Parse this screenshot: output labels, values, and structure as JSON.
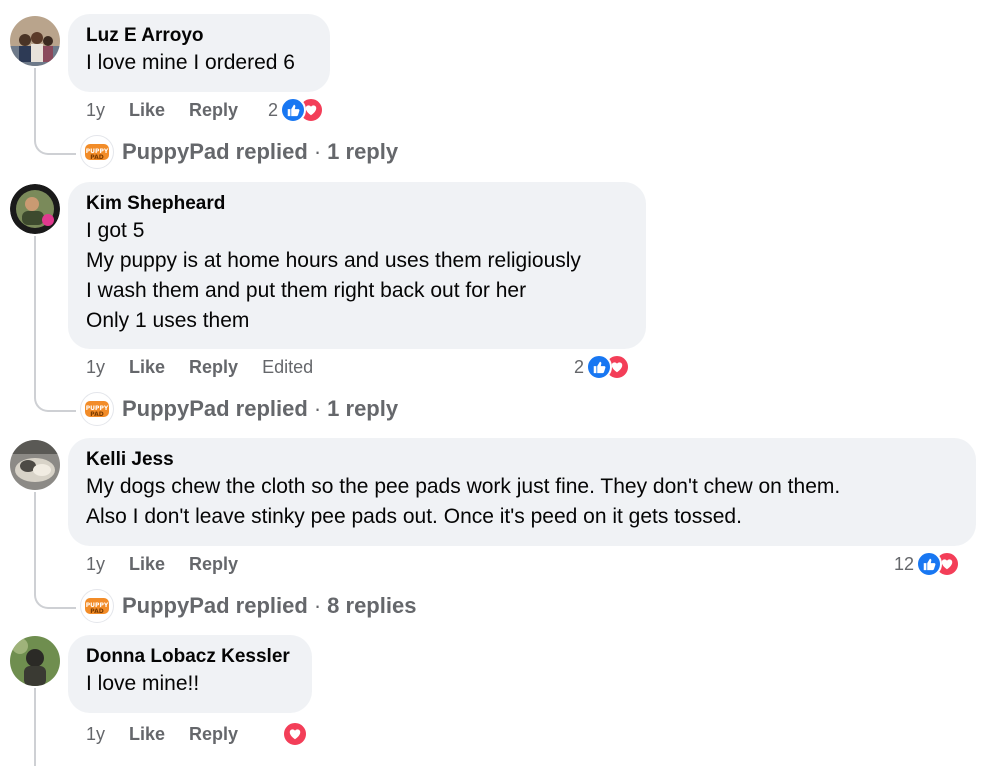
{
  "comments": [
    {
      "author": "Luz E Arroyo",
      "lines": [
        "I love mine I ordered 6"
      ],
      "age": "1y",
      "like_label": "Like",
      "reply_label": "Reply",
      "reaction_count": "2",
      "reactions": [
        "like-icon",
        "love-icon"
      ],
      "replied_by": "PuppyPad replied",
      "reply_count": "1 reply"
    },
    {
      "author": "Kim Shepheard",
      "lines": [
        "I got 5",
        "My puppy is at home hours and uses them religiously",
        "I wash them and put them right back out for her",
        "Only 1 uses them"
      ],
      "age": "1y",
      "like_label": "Like",
      "reply_label": "Reply",
      "edited_label": "Edited",
      "reaction_count": "2",
      "reactions": [
        "like-icon",
        "love-icon"
      ],
      "replied_by": "PuppyPad replied",
      "reply_count": "1 reply"
    },
    {
      "author": "Kelli Jess",
      "lines": [
        "My dogs chew the cloth so the pee pads work just fine. They don't chew on them.",
        "Also I don't leave stinky pee pads out. Once it's peed on it gets tossed."
      ],
      "age": "1y",
      "like_label": "Like",
      "reply_label": "Reply",
      "reaction_count": "12",
      "reactions": [
        "like-icon",
        "love-icon"
      ],
      "replied_by": "PuppyPad replied",
      "reply_count": "8 replies"
    },
    {
      "author": "Donna Lobacz Kessler",
      "lines": [
        "I love mine!!"
      ],
      "age": "1y",
      "like_label": "Like",
      "reply_label": "Reply",
      "reactions": [
        "love-icon"
      ]
    }
  ],
  "separator": "·",
  "colors": {
    "bubble": "#f0f2f5",
    "meta_text": "#65676b",
    "like_blue": "#1877f2",
    "love_red": "#f33e58",
    "page_logo_orange": "#f28c28"
  }
}
